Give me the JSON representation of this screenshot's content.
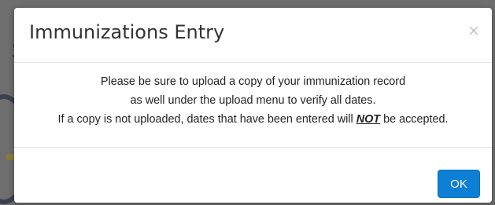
{
  "modal": {
    "title": "Immunizations Entry",
    "close_label": "×",
    "body": {
      "line1": "Please be sure to upload a copy of your immunization record",
      "line2": "as well under the upload menu to verify all dates.",
      "line3_before": "If a copy is not uploaded, dates that have been entered will ",
      "line3_emphasis": "NOT",
      "line3_after": " be accepted."
    },
    "ok_label": "OK"
  },
  "background": {
    "partial_letter": "S"
  },
  "colors": {
    "overlay": "#6e6e6e",
    "primary_button": "#0d7fd4",
    "title_text": "#333333",
    "close_icon": "#c2c2c2"
  }
}
